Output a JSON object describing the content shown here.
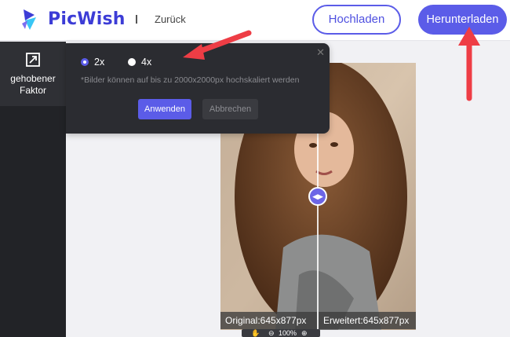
{
  "header": {
    "logo_text": "PicWish",
    "back_link": "Zurück",
    "upload_label": "Hochladen",
    "download_label": "Herunterladen"
  },
  "sidebar": {
    "tool_label": "gehobener Faktor"
  },
  "popup": {
    "options": [
      {
        "label": "2x",
        "checked": true
      },
      {
        "label": "4x",
        "checked": false
      }
    ],
    "hint": "*Bilder können auf bis zu 2000x2000px hochskaliert werden",
    "apply_label": "Anwenden",
    "cancel_label": "Abbrechen"
  },
  "preview": {
    "original_caption": "Original:645x877px",
    "enhanced_caption": "Erweitert:645x877px",
    "zoom_level": "100%"
  },
  "colors": {
    "accent": "#5b5ce8",
    "annotation_arrow": "#ee3d45",
    "sidebar_bg": "#222327",
    "popup_bg": "#2b2c31"
  },
  "icons": {
    "logo": "picwish-logo-icon",
    "tool": "upscale-expand-icon",
    "close": "close-icon",
    "compare": "compare-arrows-icon",
    "hand": "hand-pan-icon",
    "zoom_out": "zoom-out-icon",
    "zoom_in": "zoom-in-icon"
  }
}
